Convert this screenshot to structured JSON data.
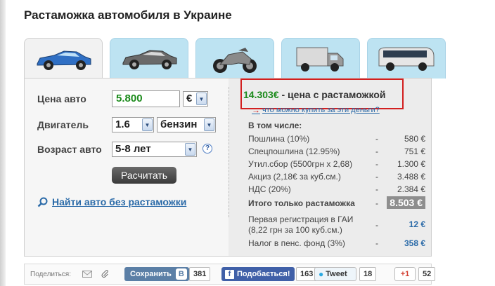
{
  "title": "Растаможка автомобиля в Украине",
  "tabs": [
    {
      "name": "tab-sports-car",
      "icon": "blue-car-icon"
    },
    {
      "name": "tab-car",
      "icon": "gray-car-icon"
    },
    {
      "name": "tab-motorcycle",
      "icon": "motorcycle-icon"
    },
    {
      "name": "tab-truck",
      "icon": "truck-icon"
    },
    {
      "name": "tab-bus",
      "icon": "bus-icon"
    }
  ],
  "form": {
    "price_label": "Цена авто",
    "price_value": "5.800",
    "currency": "€",
    "engine_label": "Двигатель",
    "engine_volume": "1.6",
    "fuel": "бензин",
    "age_label": "Возраст авто",
    "age_value": "5-8 лет",
    "help": "?",
    "calc_button": "Расчитать",
    "find_link": "Найти авто без растаможки"
  },
  "result": {
    "price": "14.303€",
    "price_suffix": " - цена с растамож­кой",
    "what_link": "что можно купить за эти деньги?",
    "included_label": "В том числе:",
    "rows": [
      {
        "name": "Пошлина (10%)",
        "dash": "-",
        "value": "580 €"
      },
      {
        "name": "Спецпошлина (12.95%)",
        "dash": "-",
        "value": "751 €"
      },
      {
        "name": "Утил.сбор (5500грн x 2,68)",
        "dash": "-",
        "value": "1.300 €"
      },
      {
        "name": "Акциз (2,18€ за куб.см.)",
        "dash": "-",
        "value": "3.488 €"
      },
      {
        "name": "НДС (20%)",
        "dash": "-",
        "value": "2.384 €"
      }
    ],
    "total": {
      "name": "Итого только растаможка",
      "dash": "-",
      "value": "8.503 €"
    },
    "registration": {
      "name_line1": "Первая регистрация в ГАИ",
      "name_line2": "(8,22 грн за 100 куб.см.)",
      "dash": "-",
      "value": "12 €"
    },
    "pension": {
      "name": "Налог в пенс. фонд (3%)",
      "dash": "-",
      "value": "358 €"
    }
  },
  "footer": {
    "share_label": "Поделиться:",
    "vk_label": "Сохранить",
    "vk_letter": "В",
    "vk_count": "381",
    "fb_label": "Подобається!",
    "fb_count": "163",
    "tw_label": "Tweet",
    "tw_count": "18",
    "gp_label": "+1",
    "gp_count": "52"
  },
  "colors": {
    "accent_green": "#1a8a1a",
    "link_blue": "#2a6aa8",
    "highlight_red": "#d21f1f",
    "tab_blue": "#bde3f2"
  }
}
